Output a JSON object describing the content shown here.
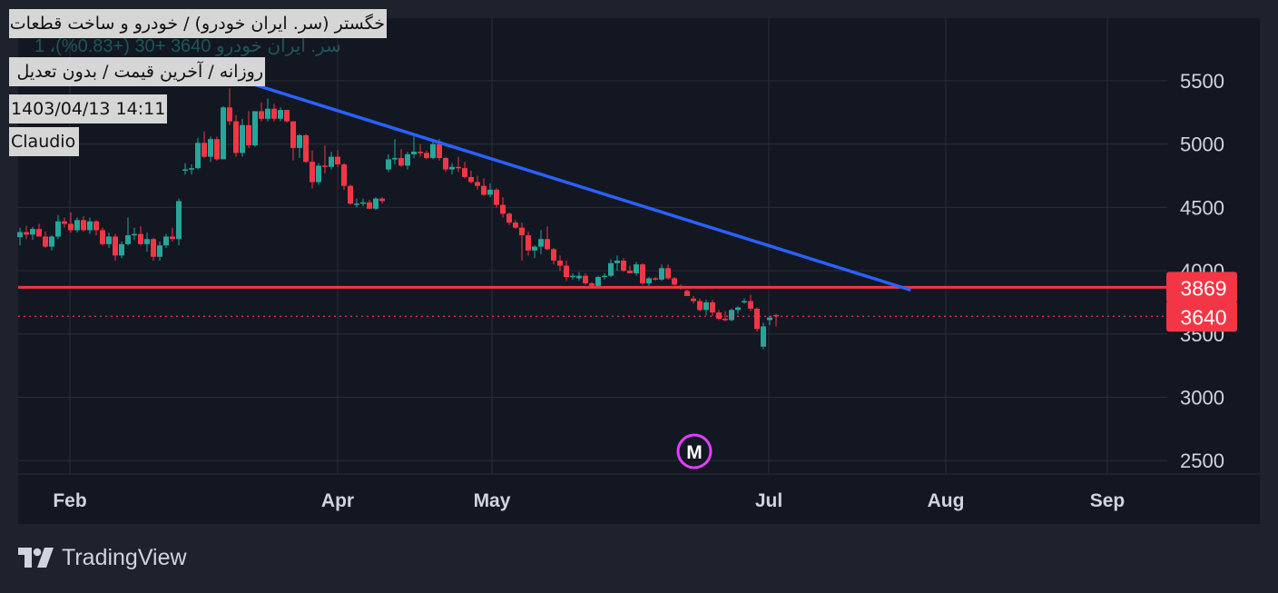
{
  "header": {
    "symbol_line": "خگستر (سر. ایران خودرو) / خودرو و ساخت قطعات",
    "interval_line": "روزانه / آخرین قیمت / بدون تعدیل",
    "timestamp": "1403/04/13 14:11",
    "author": "Claudio",
    "ghost_legend": "1 ،سر. ایران خودرو 3640 +30 (+0.83%)"
  },
  "footer": {
    "brand": "TradingView",
    "logo_icon": "tradingview-logo-icon"
  },
  "marker": {
    "label": "M",
    "color": "#e040fb"
  },
  "colors": {
    "background": "#131722",
    "frame": "#1e222d",
    "grid": "#2a2e39",
    "text": "#d1d4dc",
    "up": "#26a69a",
    "down": "#f23645",
    "trendline": "#2962ff",
    "hline": "#f23645",
    "price_badge": "#f23645"
  },
  "chart_data": {
    "type": "candlestick",
    "title": "",
    "xlabel": "",
    "ylabel": "",
    "x_ticks": [
      "Feb",
      "Apr",
      "May",
      "Jul",
      "Aug",
      "Sep"
    ],
    "y_ticks": [
      2500,
      3000,
      3500,
      4000,
      4500,
      5000,
      5500
    ],
    "ylim": [
      2400,
      5750
    ],
    "grid": true,
    "price_scale": "right",
    "horizontal_line": {
      "price": 3869,
      "label": "3869"
    },
    "last_price": {
      "price": 3640,
      "label": "3640",
      "style": "dotted"
    },
    "trendline": {
      "from": {
        "bar": 35,
        "price": 5500
      },
      "to": {
        "bar": 140,
        "price": 3850
      }
    },
    "candles": [
      [
        4265,
        4340,
        4200,
        4305
      ],
      [
        4305,
        4355,
        4250,
        4285
      ],
      [
        4285,
        4345,
        4245,
        4330
      ],
      [
        4330,
        4370,
        4270,
        4270
      ],
      [
        4270,
        4310,
        4180,
        4190
      ],
      [
        4190,
        4280,
        4160,
        4270
      ],
      [
        4270,
        4440,
        4250,
        4390
      ],
      [
        4390,
        4420,
        4340,
        4370
      ],
      [
        4370,
        4460,
        4300,
        4320
      ],
      [
        4320,
        4420,
        4300,
        4400
      ],
      [
        4400,
        4430,
        4310,
        4320
      ],
      [
        4320,
        4420,
        4290,
        4390
      ],
      [
        4390,
        4400,
        4280,
        4320
      ],
      [
        4320,
        4340,
        4200,
        4210
      ],
      [
        4210,
        4300,
        4180,
        4270
      ],
      [
        4270,
        4290,
        4080,
        4120
      ],
      [
        4120,
        4230,
        4100,
        4210
      ],
      [
        4210,
        4420,
        4200,
        4280
      ],
      [
        4280,
        4340,
        4240,
        4290
      ],
      [
        4290,
        4350,
        4200,
        4210
      ],
      [
        4210,
        4300,
        4150,
        4250
      ],
      [
        4250,
        4260,
        4080,
        4110
      ],
      [
        4110,
        4230,
        4080,
        4200
      ],
      [
        4200,
        4290,
        4180,
        4270
      ],
      [
        4270,
        4340,
        4230,
        4250
      ],
      [
        4250,
        4570,
        4200,
        4550
      ],
      [
        4800,
        4850,
        4760,
        4800
      ],
      [
        4800,
        4840,
        4760,
        4810
      ],
      [
        4810,
        5050,
        4800,
        5010
      ],
      [
        5010,
        5100,
        4890,
        4900
      ],
      [
        4900,
        5060,
        4860,
        5040
      ],
      [
        5040,
        5060,
        4870,
        4880
      ],
      [
        4880,
        5300,
        4880,
        5290
      ],
      [
        5290,
        5440,
        5150,
        5180
      ],
      [
        5180,
        5230,
        4900,
        4930
      ],
      [
        4930,
        5200,
        4900,
        5150
      ],
      [
        5150,
        5260,
        4970,
        4990
      ],
      [
        4990,
        5260,
        4980,
        5260
      ],
      [
        5260,
        5330,
        5180,
        5200
      ],
      [
        5200,
        5360,
        5180,
        5280
      ],
      [
        5280,
        5320,
        5180,
        5200
      ],
      [
        5200,
        5290,
        5180,
        5270
      ],
      [
        5270,
        5270,
        5170,
        5180
      ],
      [
        5180,
        5070,
        4870,
        4970
      ],
      [
        4970,
        5080,
        4890,
        5070
      ],
      [
        5070,
        5080,
        4850,
        4860
      ],
      [
        4860,
        4950,
        4650,
        4700
      ],
      [
        4700,
        4850,
        4680,
        4830
      ],
      [
        4830,
        4990,
        4770,
        4820
      ],
      [
        4820,
        4940,
        4800,
        4900
      ],
      [
        4900,
        4950,
        4820,
        4840
      ],
      [
        4840,
        4850,
        4640,
        4670
      ],
      [
        4670,
        4680,
        4520,
        4530
      ],
      [
        4530,
        4570,
        4500,
        4530
      ],
      [
        4530,
        4570,
        4510,
        4540
      ],
      [
        4540,
        4560,
        4490,
        4490
      ],
      [
        4490,
        4580,
        4480,
        4570
      ],
      [
        4570,
        4580,
        4530,
        4550
      ],
      [
        4800,
        4920,
        4780,
        4880
      ],
      [
        4880,
        5040,
        4840,
        4890
      ],
      [
        4890,
        4960,
        4820,
        4830
      ],
      [
        4830,
        4940,
        4800,
        4920
      ],
      [
        4920,
        5060,
        4890,
        4940
      ],
      [
        4940,
        5000,
        4900,
        4930
      ],
      [
        4930,
        4950,
        4880,
        4890
      ],
      [
        4890,
        5030,
        4880,
        5000
      ],
      [
        5000,
        5040,
        4870,
        4890
      ],
      [
        4890,
        4900,
        4780,
        4800
      ],
      [
        4800,
        4850,
        4760,
        4820
      ],
      [
        4820,
        4900,
        4780,
        4810
      ],
      [
        4810,
        4860,
        4730,
        4740
      ],
      [
        4740,
        4790,
        4690,
        4700
      ],
      [
        4700,
        4750,
        4640,
        4670
      ],
      [
        4670,
        4730,
        4590,
        4600
      ],
      [
        4600,
        4690,
        4580,
        4640
      ],
      [
        4640,
        4650,
        4500,
        4520
      ],
      [
        4520,
        4580,
        4420,
        4450
      ],
      [
        4450,
        4460,
        4360,
        4380
      ],
      [
        4380,
        4400,
        4330,
        4340
      ],
      [
        4340,
        4380,
        4080,
        4280
      ],
      [
        4280,
        4310,
        4120,
        4160
      ],
      [
        4160,
        4200,
        4100,
        4190
      ],
      [
        4190,
        4320,
        4130,
        4250
      ],
      [
        4250,
        4350,
        4160,
        4170
      ],
      [
        4170,
        4180,
        4050,
        4080
      ],
      [
        4080,
        4120,
        4000,
        4040
      ],
      [
        4040,
        4080,
        3920,
        3950
      ],
      [
        3950,
        3980,
        3930,
        3960
      ],
      [
        3940,
        3990,
        3920,
        3960
      ],
      [
        3960,
        3980,
        3890,
        3900
      ],
      [
        3900,
        3910,
        3870,
        3880
      ],
      [
        3880,
        3960,
        3870,
        3950
      ],
      [
        3950,
        3980,
        3930,
        3960
      ],
      [
        3960,
        4090,
        3950,
        4060
      ],
      [
        4060,
        4120,
        4000,
        4080
      ],
      [
        4080,
        4100,
        3990,
        4000
      ],
      [
        4000,
        4040,
        3980,
        3980
      ],
      [
        3980,
        4070,
        3960,
        4050
      ],
      [
        4050,
        4060,
        3890,
        3900
      ],
      [
        3900,
        3950,
        3880,
        3940
      ],
      [
        3940,
        3950,
        3920,
        3930
      ],
      [
        3930,
        4050,
        3920,
        4020
      ],
      [
        4020,
        4050,
        3930,
        3940
      ],
      [
        3940,
        3950,
        3880,
        3890
      ],
      [
        3880,
        3890,
        3850,
        3860
      ],
      [
        3840,
        3850,
        3800,
        3800
      ],
      [
        3780,
        3800,
        3740,
        3760
      ],
      [
        3760,
        3780,
        3680,
        3690
      ],
      [
        3690,
        3770,
        3650,
        3750
      ],
      [
        3750,
        3770,
        3640,
        3670
      ],
      [
        3670,
        3690,
        3610,
        3620
      ],
      [
        3620,
        3680,
        3600,
        3610
      ],
      [
        3610,
        3700,
        3600,
        3690
      ],
      [
        3690,
        3720,
        3660,
        3710
      ],
      [
        3760,
        3780,
        3740,
        3760
      ],
      [
        3760,
        3810,
        3680,
        3700
      ],
      [
        3700,
        3710,
        3520,
        3540
      ],
      [
        3400,
        3590,
        3380,
        3560
      ],
      [
        3610,
        3640,
        3570,
        3630
      ],
      [
        3650,
        3660,
        3560,
        3640
      ]
    ]
  }
}
